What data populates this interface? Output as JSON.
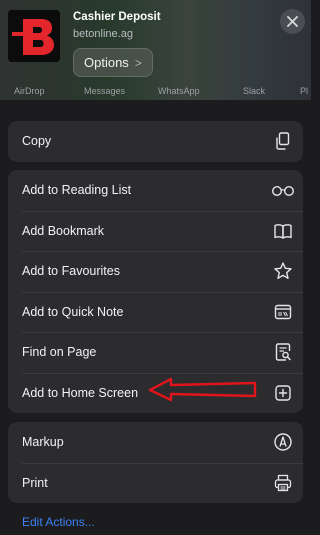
{
  "header": {
    "site_title": "Cashier Deposit",
    "site_url": "betonline.ag",
    "options_label": "Options",
    "options_chevron": ">",
    "close_icon": "close-icon",
    "logo_letter": "B"
  },
  "share_strip": [
    "AirDrop",
    "Messages",
    "WhatsApp",
    "Slack",
    "Pl"
  ],
  "groups": {
    "copy": [
      {
        "label": "Copy",
        "icon": "copy-icon"
      }
    ],
    "actions": [
      {
        "label": "Add to Reading List",
        "icon": "glasses-icon"
      },
      {
        "label": "Add Bookmark",
        "icon": "book-icon"
      },
      {
        "label": "Add to Favourites",
        "icon": "star-icon"
      },
      {
        "label": "Add to Quick Note",
        "icon": "quick-note-icon"
      },
      {
        "label": "Find on Page",
        "icon": "find-on-page-icon"
      },
      {
        "label": "Add to Home Screen",
        "icon": "add-square-icon"
      }
    ],
    "extras": [
      {
        "label": "Markup",
        "icon": "markup-icon"
      },
      {
        "label": "Print",
        "icon": "printer-icon"
      }
    ]
  },
  "edit_actions_label": "Edit Actions...",
  "colors": {
    "background": "#1c1c1e",
    "row_background": "#2c2c2e",
    "link": "#3b82f6",
    "logo_red": "#e3262b",
    "annotation_red": "#e0151b"
  }
}
